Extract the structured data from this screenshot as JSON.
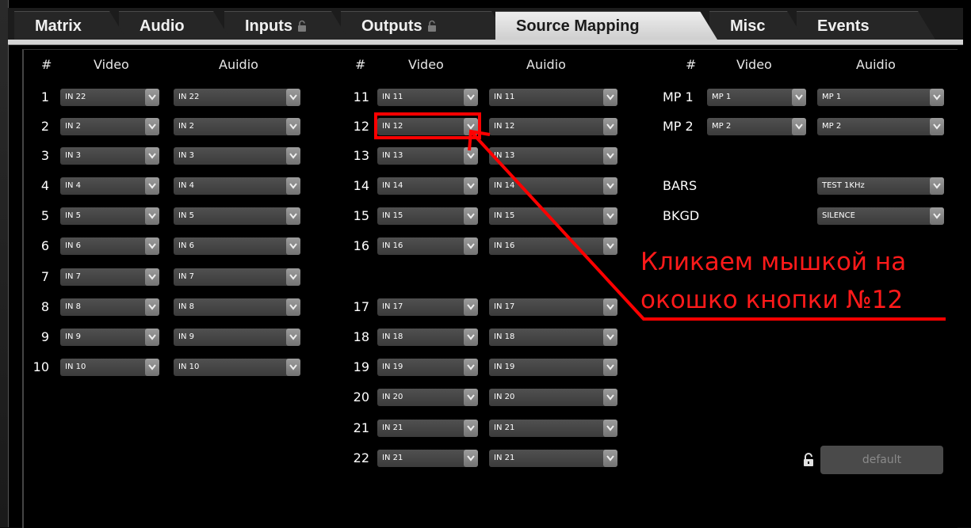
{
  "tabs": [
    {
      "label": "Matrix",
      "active": false,
      "locked": false
    },
    {
      "label": "Audio",
      "active": false,
      "locked": false
    },
    {
      "label": "Inputs",
      "active": false,
      "locked": true
    },
    {
      "label": "Outputs",
      "active": false,
      "locked": true
    },
    {
      "label": "Source Mapping",
      "active": true,
      "locked": false
    },
    {
      "label": "Misc",
      "active": false,
      "locked": false
    },
    {
      "label": "Events",
      "active": false,
      "locked": false
    }
  ],
  "headers": {
    "hash": "#",
    "video": "Video",
    "audio": "Auidio"
  },
  "col1": [
    {
      "num": "1",
      "video": "IN 22",
      "audio": "IN 22"
    },
    {
      "num": "2",
      "video": "IN 2",
      "audio": "IN 2"
    },
    {
      "num": "3",
      "video": "IN 3",
      "audio": "IN 3"
    },
    {
      "num": "4",
      "video": "IN 4",
      "audio": "IN 4"
    },
    {
      "num": "5",
      "video": "IN 5",
      "audio": "IN 5"
    },
    {
      "num": "6",
      "video": "IN 6",
      "audio": "IN 6"
    },
    {
      "num": "7",
      "video": "IN 7",
      "audio": "IN 7"
    },
    {
      "num": "8",
      "video": "IN 8",
      "audio": "IN 8"
    },
    {
      "num": "9",
      "video": "IN 9",
      "audio": "IN 9"
    },
    {
      "num": "10",
      "video": "IN 10",
      "audio": "IN 10"
    }
  ],
  "col2": [
    {
      "num": "11",
      "video": "IN 11",
      "audio": "IN 11"
    },
    {
      "num": "12",
      "video": "IN 12",
      "audio": "IN 12"
    },
    {
      "num": "13",
      "video": "IN 13",
      "audio": "IN 13"
    },
    {
      "num": "14",
      "video": "IN 14",
      "audio": "IN 14"
    },
    {
      "num": "15",
      "video": "IN 15",
      "audio": "IN 15"
    },
    {
      "num": "16",
      "video": "IN 16",
      "audio": "IN 16"
    },
    {
      "num": "17",
      "video": "IN 17",
      "audio": "IN 17"
    },
    {
      "num": "18",
      "video": "IN 18",
      "audio": "IN 18"
    },
    {
      "num": "19",
      "video": "IN 19",
      "audio": "IN 19"
    },
    {
      "num": "20",
      "video": "IN 20",
      "audio": "IN 20"
    },
    {
      "num": "21",
      "video": "IN 21",
      "audio": "IN 21"
    },
    {
      "num": "22",
      "video": "IN 21",
      "audio": "IN 21"
    }
  ],
  "col3": [
    {
      "label": "MP 1",
      "video": "MP 1",
      "audio": "MP 1"
    },
    {
      "label": "MP 2",
      "video": "MP 2",
      "audio": "MP 2"
    }
  ],
  "specials": [
    {
      "label": "BARS",
      "audio": "TEST 1KHz"
    },
    {
      "label": "BKGD",
      "audio": "SILENCE"
    }
  ],
  "default_label": "default",
  "annotation": {
    "line1": "Кликаем мышкой на",
    "line2": "окошко кнопки №12",
    "color": "#ff0000"
  }
}
